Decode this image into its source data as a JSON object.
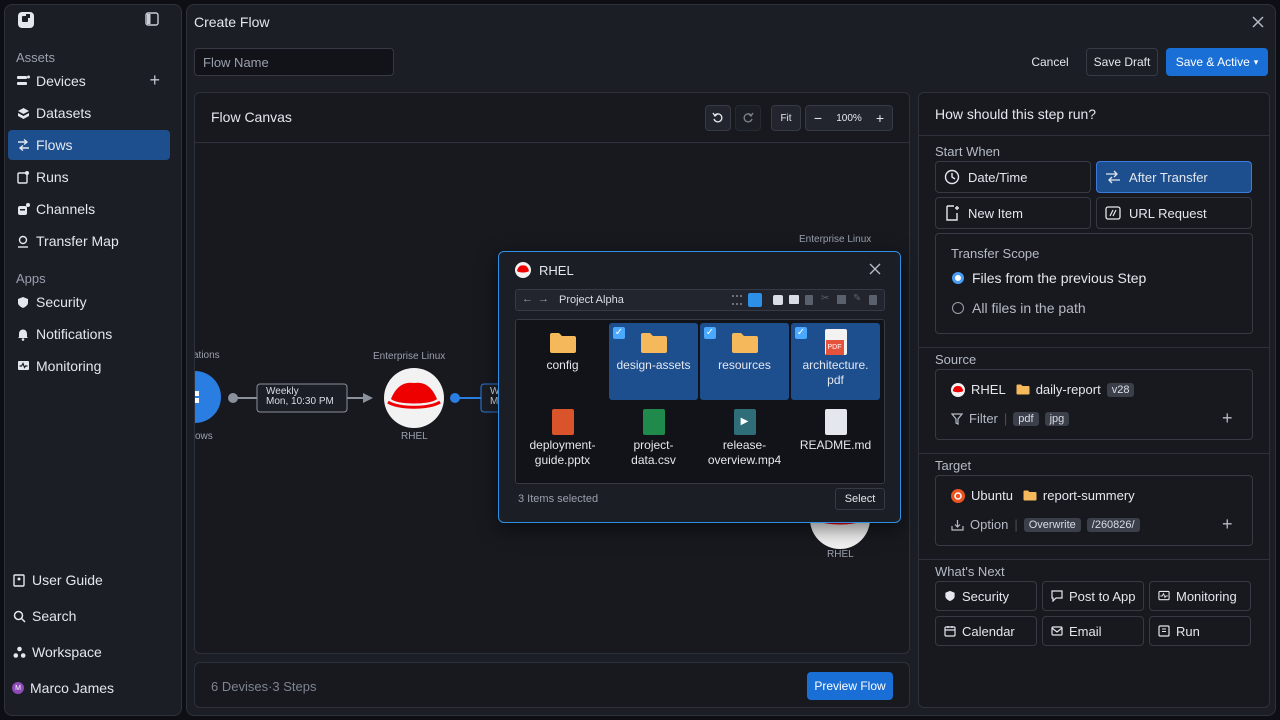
{
  "sidebar": {
    "assets_label": "Assets",
    "apps_label": "Apps",
    "items": [
      {
        "label": "Devices"
      },
      {
        "label": "Datasets"
      },
      {
        "label": "Flows"
      },
      {
        "label": "Runs"
      },
      {
        "label": "Channels"
      },
      {
        "label": "Transfer Map"
      }
    ],
    "apps": [
      {
        "label": "Security"
      },
      {
        "label": "Notifications"
      },
      {
        "label": "Monitoring"
      }
    ],
    "bottom": [
      {
        "label": "User Guide"
      },
      {
        "label": "Search"
      },
      {
        "label": "Workspace"
      },
      {
        "label": "Marco James"
      }
    ],
    "avatar_initial": "M"
  },
  "header": {
    "title": "Create Flow",
    "flow_name_placeholder": "Flow Name",
    "cancel": "Cancel",
    "save_draft": "Save Draft",
    "save_active": "Save & Active"
  },
  "canvas": {
    "title": "Flow Canvas",
    "fit": "Fit",
    "zoom": "100%",
    "nodes": {
      "left_partial_top": "ations",
      "left_partial_bottom": "ows",
      "schedule_line1": "Weekly",
      "schedule_line2": "Mon, 10:30 PM",
      "rhel_caption_top": "Enterprise Linux",
      "rhel_label": "RHEL",
      "right_caption_top": "Enterprise Linux",
      "right_label": "RHEL",
      "partial_box_line1": "W",
      "partial_box_line2": "M"
    }
  },
  "footer": {
    "summary": "6 Devises·3 Steps",
    "preview": "Preview Flow"
  },
  "dialog": {
    "title": "RHEL",
    "path": "Project Alpha",
    "selected_count": "3 Items selected",
    "select": "Select",
    "items": [
      {
        "name": "config",
        "selected": false
      },
      {
        "name": "design-assets",
        "selected": true
      },
      {
        "name": "resources",
        "selected": true
      },
      {
        "name": "architecture.pdf",
        "selected": true
      },
      {
        "name": "deployment-guide.pptx",
        "selected": false
      },
      {
        "name": "project-data.csv",
        "selected": false
      },
      {
        "name": "release-overview.mp4",
        "selected": false
      },
      {
        "name": "README.md",
        "selected": false
      }
    ],
    "item_lines": [
      [
        "config"
      ],
      [
        "design-assets"
      ],
      [
        "resources"
      ],
      [
        "architecture.",
        "pdf"
      ],
      [
        "deployment-",
        "guide.pptx"
      ],
      [
        "project-",
        "data.csv"
      ],
      [
        "release-",
        "overview.mp4"
      ],
      [
        "README.md"
      ]
    ],
    "pdf_badge": "PDF"
  },
  "panel": {
    "heading": "How should this step run?",
    "start_when": "Start When",
    "start_options": [
      {
        "label": "Date/Time"
      },
      {
        "label": "After Transfer"
      },
      {
        "label": "New Item"
      },
      {
        "label": "URL Request"
      }
    ],
    "transfer_scope": "Transfer Scope",
    "scope_options": [
      {
        "label": "Files from the previous Step"
      },
      {
        "label": "All files in the path"
      }
    ],
    "source_label": "Source",
    "source": {
      "device": "RHEL",
      "folder": "daily-report",
      "version": "v28",
      "filter_label": "Filter",
      "filters": [
        "pdf",
        "jpg"
      ]
    },
    "target_label": "Target",
    "target": {
      "device": "Ubuntu",
      "folder": "report-summery",
      "option_label": "Option",
      "options": [
        "Overwrite",
        "/260826/"
      ]
    },
    "next_label": "What's Next",
    "next": [
      {
        "label": "Security"
      },
      {
        "label": "Post to App"
      },
      {
        "label": "Monitoring"
      },
      {
        "label": "Calendar"
      },
      {
        "label": "Email"
      },
      {
        "label": "Run"
      }
    ]
  },
  "colors": {
    "accent": "#1a6fd6",
    "active_bg": "#1d4f8f",
    "rhel_red": "#e00"
  }
}
